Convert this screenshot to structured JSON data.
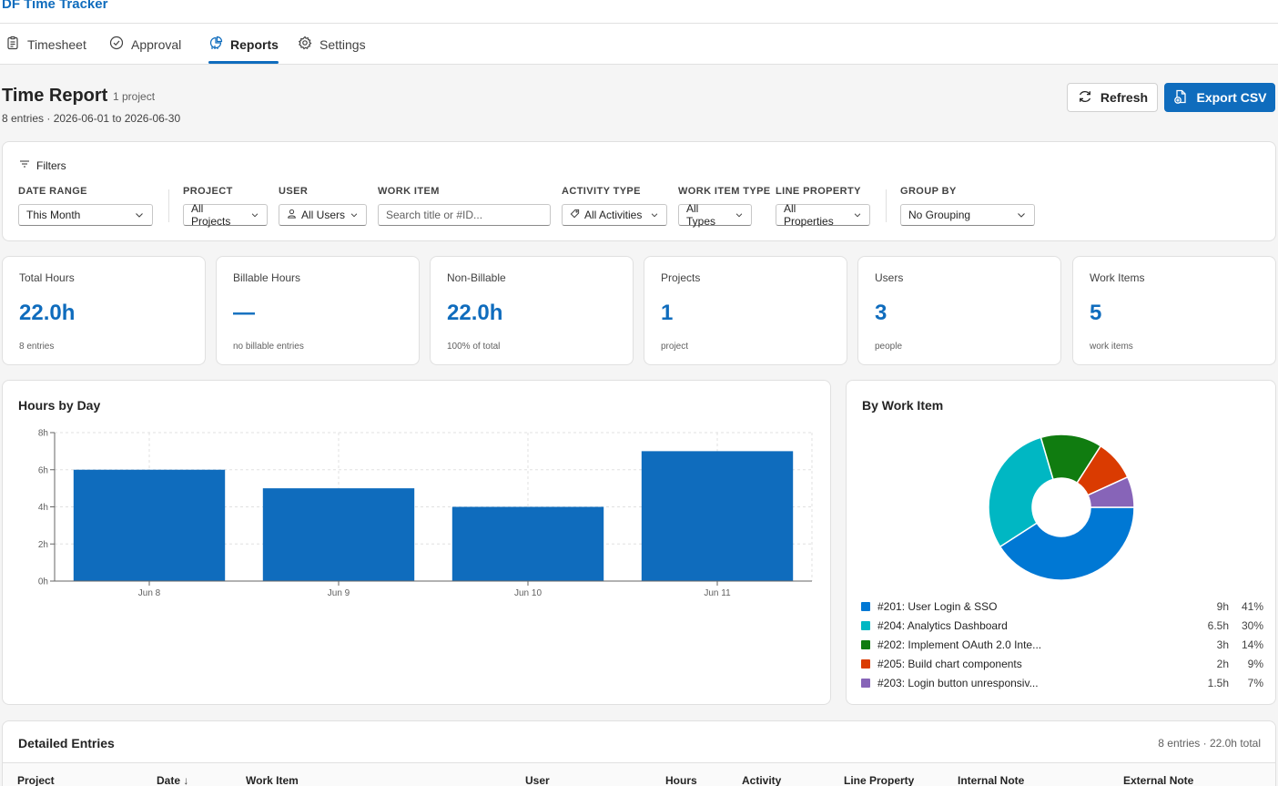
{
  "app": {
    "title": "DF Time Tracker"
  },
  "nav": {
    "tabs": [
      {
        "label": "Timesheet",
        "icon": "clipboard-icon"
      },
      {
        "label": "Approval",
        "icon": "check-circle-icon"
      },
      {
        "label": "Reports",
        "icon": "chart-icon",
        "active": true
      },
      {
        "label": "Settings",
        "icon": "gear-icon"
      }
    ]
  },
  "header": {
    "title": "Time Report",
    "badge": "1 project",
    "subtitle": "8 entries · 2026-06-01 to 2026-06-30",
    "refresh_label": "Refresh",
    "export_label": "Export CSV"
  },
  "filters": {
    "title": "Filters",
    "date_range": {
      "label": "DATE RANGE",
      "value": "This Month"
    },
    "project": {
      "label": "PROJECT",
      "value": "All Projects"
    },
    "user": {
      "label": "USER",
      "value": "All Users"
    },
    "work_item": {
      "label": "WORK ITEM",
      "placeholder": "Search title or #ID..."
    },
    "activity_type": {
      "label": "ACTIVITY TYPE",
      "value": "All Activities"
    },
    "work_item_type": {
      "label": "WORK ITEM TYPE",
      "value": "All Types"
    },
    "line_property": {
      "label": "LINE PROPERTY",
      "value": "All Properties"
    },
    "group_by": {
      "label": "GROUP BY",
      "value": "No Grouping"
    }
  },
  "stats": [
    {
      "label": "Total Hours",
      "value": "22.0h",
      "sub": "8 entries"
    },
    {
      "label": "Billable Hours",
      "value": "—",
      "sub": "no billable entries"
    },
    {
      "label": "Non-Billable",
      "value": "22.0h",
      "sub": "100% of total"
    },
    {
      "label": "Projects",
      "value": "1",
      "sub": "project"
    },
    {
      "label": "Users",
      "value": "3",
      "sub": "people"
    },
    {
      "label": "Work Items",
      "value": "5",
      "sub": "work items"
    }
  ],
  "hours_chart": {
    "title": "Hours by Day"
  },
  "work_item_chart": {
    "title": "By Work Item"
  },
  "chart_data": [
    {
      "type": "bar",
      "title": "Hours by Day",
      "categories": [
        "Jun 8",
        "Jun 9",
        "Jun 10",
        "Jun 11"
      ],
      "values": [
        6,
        5,
        4,
        7
      ],
      "ylim": [
        0,
        8
      ],
      "yticks": [
        "0h",
        "2h",
        "4h",
        "6h",
        "8h"
      ],
      "grid": true,
      "color": "#0f6cbd"
    },
    {
      "type": "pie",
      "title": "By Work Item",
      "donut": true,
      "legend_placement": "bottom",
      "slices": [
        {
          "label": "#201: User Login & SSO",
          "value": 9,
          "hours": "9h",
          "pct": "41%",
          "color": "#0078d4"
        },
        {
          "label": "#204: Analytics Dashboard",
          "value": 6.5,
          "hours": "6.5h",
          "pct": "30%",
          "color": "#00b7c3"
        },
        {
          "label": "#202: Implement OAuth 2.0 Inte...",
          "value": 3,
          "hours": "3h",
          "pct": "14%",
          "color": "#107c10"
        },
        {
          "label": "#205: Build chart components",
          "value": 2,
          "hours": "2h",
          "pct": "9%",
          "color": "#da3b01"
        },
        {
          "label": "#203: Login button unresponsiv...",
          "value": 1.5,
          "hours": "1.5h",
          "pct": "7%",
          "color": "#8764b8"
        }
      ]
    }
  ],
  "entries": {
    "title": "Detailed Entries",
    "summary": "8 entries · 22.0h total",
    "columns": [
      "Project",
      "Date",
      "Work Item",
      "User",
      "Hours",
      "Activity",
      "Line Property",
      "Internal Note",
      "External Note"
    ],
    "sort_indicator": "↓"
  }
}
